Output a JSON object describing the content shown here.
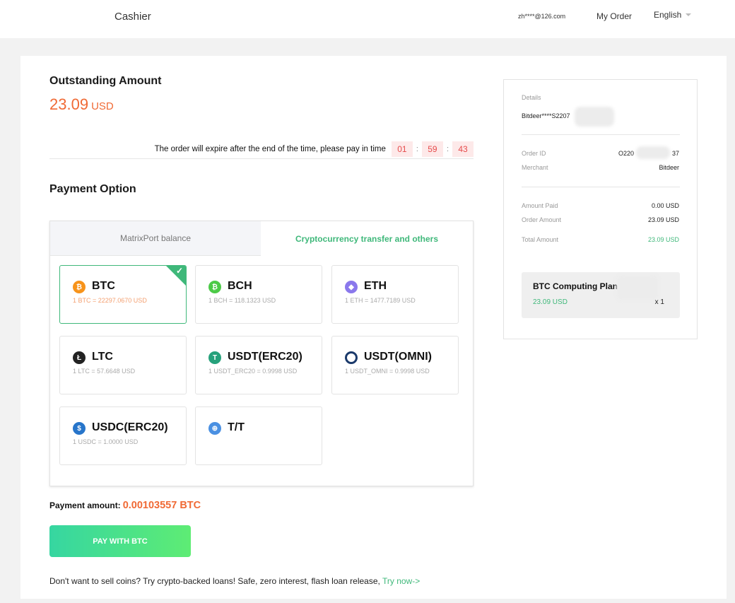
{
  "header": {
    "brand": "Cashier",
    "email": "zh****@126.com",
    "my_order": "My Order",
    "language": "English"
  },
  "outstanding": {
    "title": "Outstanding Amount",
    "amount": "23.09",
    "currency": "USD"
  },
  "expiry": {
    "message": "The order will expire after the end of the time, please pay in time",
    "hours": "01",
    "minutes": "59",
    "seconds": "43",
    "separator": ":"
  },
  "payment_option": {
    "title": "Payment Option",
    "tabs": [
      {
        "label": "MatrixPort balance",
        "active": false
      },
      {
        "label": "Cryptocurrency transfer and others",
        "active": true
      }
    ],
    "coins": [
      {
        "name": "BTC",
        "rate": "1 BTC = 22297.0670 USD",
        "selected": true,
        "icon": "btc-icon",
        "color": "#f7931a"
      },
      {
        "name": "BCH",
        "rate": "1 BCH = 118.1323 USD",
        "selected": false,
        "icon": "bch-icon",
        "color": "#4cca47"
      },
      {
        "name": "ETH",
        "rate": "1 ETH = 1477.7189 USD",
        "selected": false,
        "icon": "eth-icon",
        "color": "#8a78ec"
      },
      {
        "name": "LTC",
        "rate": "1 LTC = 57.6648 USD",
        "selected": false,
        "icon": "ltc-icon",
        "color": "#222222"
      },
      {
        "name": "USDT(ERC20)",
        "rate": "1 USDT_ERC20 = 0.9998 USD",
        "selected": false,
        "icon": "usdt-erc20-icon",
        "color": "#26a17b"
      },
      {
        "name": "USDT(OMNI)",
        "rate": "1 USDT_OMNI = 0.9998 USD",
        "selected": false,
        "icon": "usdt-omni-icon",
        "color": "#1b3a6b"
      },
      {
        "name": "USDC(ERC20)",
        "rate": "1 USDC = 1.0000 USD",
        "selected": false,
        "icon": "usdc-icon",
        "color": "#2775ca"
      },
      {
        "name": "T/T",
        "rate": "",
        "selected": false,
        "icon": "bank-transfer-icon",
        "color": "#4a90e2"
      }
    ]
  },
  "payment_amount": {
    "label": "Payment amount:",
    "value": "0.00103557 BTC"
  },
  "pay_button": "PAY WITH BTC",
  "promo": {
    "text": "Don't want to sell coins? Try crypto-backed loans! Safe, zero interest, flash loan release,",
    "link": "Try now->"
  },
  "details": {
    "heading": "Details",
    "account": "Bitdeer****S2207",
    "order_id_label": "Order ID",
    "order_id_prefix": "O220",
    "order_id_suffix": "37",
    "merchant_label": "Merchant",
    "merchant": "Bitdeer",
    "amount_paid_label": "Amount Paid",
    "amount_paid": "0.00 USD",
    "order_amount_label": "Order Amount",
    "order_amount": "23.09 USD",
    "total_amount_label": "Total Amount",
    "total_amount": "23.09 USD",
    "plan_name": "BTC Computing Plan",
    "plan_price": "23.09 USD",
    "plan_qty": "x 1",
    "accent_color": "#3fb87a"
  }
}
